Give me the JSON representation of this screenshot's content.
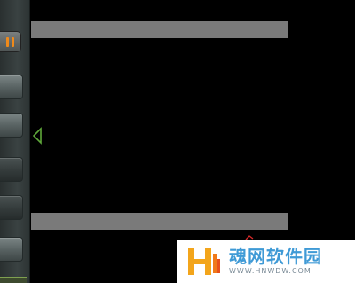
{
  "toolbar": {
    "pause_icon": "pause-icon",
    "pause_color": "#f08a1a",
    "buttons": [
      "tool-button",
      "tool-button",
      "tool-button",
      "tool-button",
      "tool-button",
      "tool-button"
    ]
  },
  "canvas": {
    "background": "#000000",
    "bar_color": "#7a7a7a",
    "marker_icon": "triangle-left-outline-icon",
    "marker_color": "#5fa83a"
  },
  "watermark": {
    "title": "魂网软件园",
    "url": "WWW.HNWDW.COM",
    "title_color": "#3f9ad6"
  }
}
